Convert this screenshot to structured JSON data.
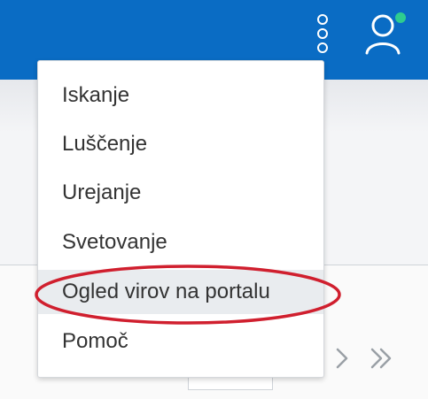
{
  "topbar": {
    "background": "#0a6cc4",
    "kebab_icon": "three-dots-vertical",
    "avatar_icon": "user",
    "presence_color": "#2ecc8f"
  },
  "menu": {
    "items": [
      {
        "label": "Iskanje"
      },
      {
        "label": "Luščenje"
      },
      {
        "label": "Urejanje"
      },
      {
        "label": "Svetovanje"
      },
      {
        "label": "Ogled virov na portalu"
      },
      {
        "label": "Pomoč"
      }
    ],
    "highlighted_index": 4
  },
  "annotation": {
    "color": "#d01f2e"
  },
  "pager": {
    "next_icon": "chevron-right",
    "last_icon": "double-chevron-right"
  }
}
